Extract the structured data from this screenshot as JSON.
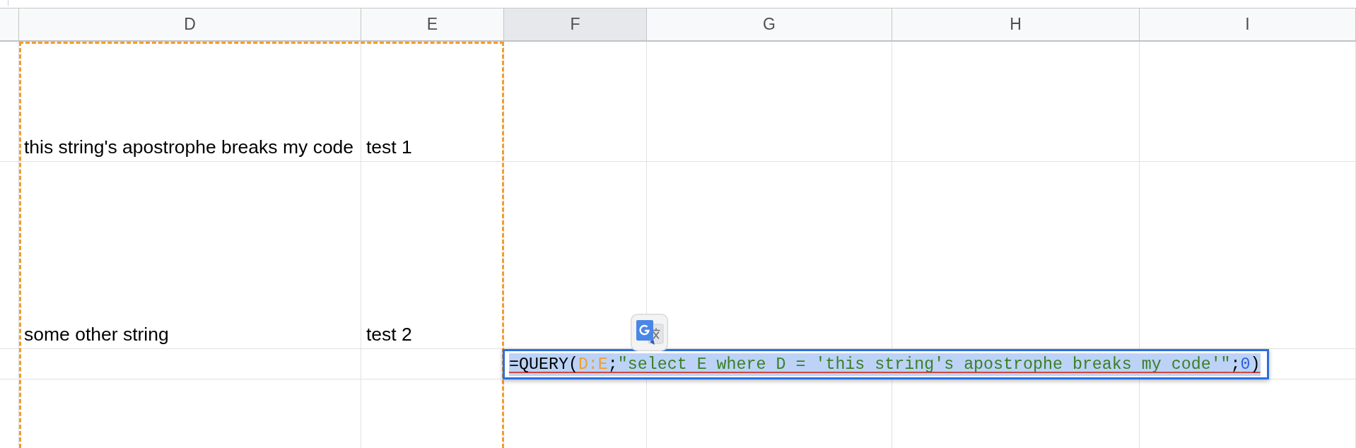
{
  "column_headers": [
    {
      "label": "D",
      "selected": false
    },
    {
      "label": "E",
      "selected": false
    },
    {
      "label": "F",
      "selected": true
    },
    {
      "label": "G",
      "selected": false
    },
    {
      "label": "H",
      "selected": false
    },
    {
      "label": "I",
      "selected": false
    }
  ],
  "rows": [
    {
      "cells": [
        "this string's apostrophe breaks my code",
        "test 1"
      ]
    },
    {
      "cells": [
        "some other string",
        "test 2"
      ]
    }
  ],
  "cell_editor": {
    "text_selected": true,
    "error": true,
    "tokens": [
      {
        "kind": "function",
        "text": "=QUERY("
      },
      {
        "kind": "range",
        "text": "D:E"
      },
      {
        "kind": "separator",
        "text": ";"
      },
      {
        "kind": "string",
        "text": "\"select E where D = 'this string's apostrophe breaks my code'\""
      },
      {
        "kind": "separator",
        "text": ";"
      },
      {
        "kind": "number",
        "text": "0"
      },
      {
        "kind": "separator",
        "text": ")"
      }
    ]
  }
}
